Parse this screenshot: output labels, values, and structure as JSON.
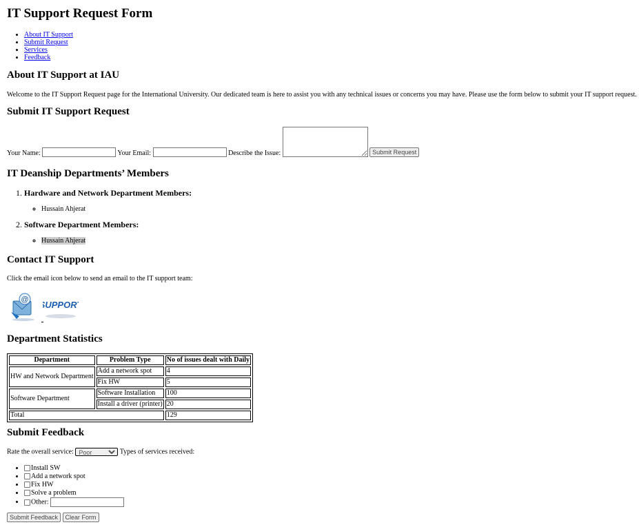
{
  "page": {
    "title": "IT Support Request Form"
  },
  "nav": {
    "items": [
      {
        "label": "About IT Support"
      },
      {
        "label": "Submit Request"
      },
      {
        "label": "Services"
      },
      {
        "label": "Feedback"
      }
    ]
  },
  "about": {
    "heading": "About IT Support at IAU",
    "text": "Welcome to the IT Support Request page for the International University. Our dedicated team is here to assist you with any technical issues or concerns you may have. Please use the form below to submit your IT support request."
  },
  "request_form": {
    "heading": "Submit IT Support Request",
    "name_label": "Your Name:",
    "name_value": "",
    "email_label": "Your Email:",
    "email_value": "",
    "issue_label": "Describe the Issue:",
    "issue_value": "",
    "submit_label": "Submit Request"
  },
  "departments": {
    "heading": "IT Deanship Departments’ Members",
    "items": [
      {
        "title": "Hardware and Network Department Members:",
        "members": [
          "Hussain Ahjerat"
        ]
      },
      {
        "title": "Software Department Members:",
        "members": [
          "Hussain Ahjerat"
        ]
      }
    ]
  },
  "contact": {
    "heading": "Contact IT Support",
    "text": "Click the email icon below to send an email to the IT support team:",
    "support_logo_text": "SUPPORT",
    "icons": [
      "email-icon",
      "support-logo-icon"
    ]
  },
  "stats": {
    "heading": "Department Statistics",
    "headers": [
      "Department",
      "Problem Type",
      "No of issues dealt with Daily"
    ],
    "rows": [
      {
        "department": "HW and Network Department",
        "problems": [
          {
            "type": "Add a network spot",
            "count": "4"
          },
          {
            "type": "Fix HW",
            "count": "5"
          }
        ]
      },
      {
        "department": "Software Department",
        "problems": [
          {
            "type": "Software Installation",
            "count": "100"
          },
          {
            "type": "Install a driver (printer)",
            "count": "20"
          }
        ]
      }
    ],
    "total_label": "Total",
    "total_value": "129"
  },
  "feedback": {
    "heading": "Submit Feedback",
    "rate_label": "Rate the overall service:",
    "rate_selected": "Poor",
    "services_label": "Types of services received:",
    "services": [
      "Install SW",
      "Add a network spot",
      "Fix HW",
      "Solve a problem",
      "Other:"
    ],
    "other_value": "",
    "submit_label": "Submit Feedback",
    "clear_label": "Clear Form"
  }
}
